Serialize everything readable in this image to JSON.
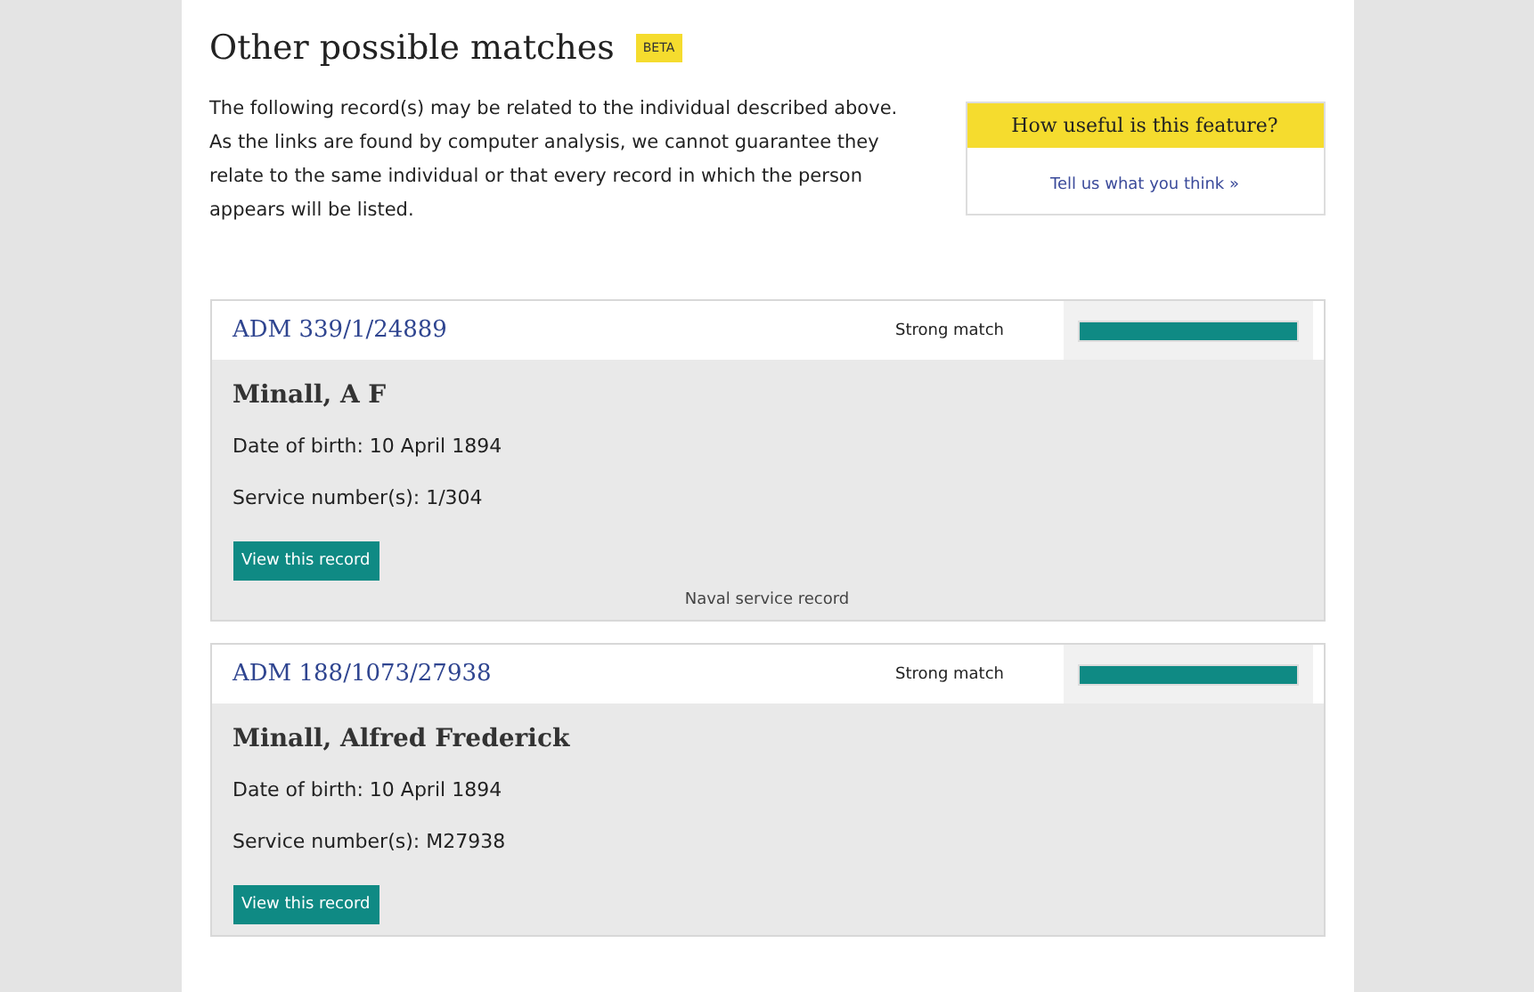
{
  "section": {
    "title": "Other possible matches",
    "badge": "BETA",
    "intro": "The following record(s) may be related to the individual described above. As the links are found by computer analysis, we cannot guarantee they relate to the same individual or that every record in which the person appears will be listed."
  },
  "feedback": {
    "question": "How useful is this feature?",
    "link": "Tell us what you think »"
  },
  "matches": [
    {
      "reference": "ADM 339/1/24889",
      "strength": "Strong match",
      "level": 1.0,
      "name": "Minall, A F",
      "birth": "Date of birth: 10 April 1894",
      "service": "Service number(s): 1/304",
      "button": "View this record",
      "record_type": "Naval service record"
    },
    {
      "reference": "ADM 188/1073/27938",
      "strength": "Strong match",
      "level": 1.0,
      "name": "Minall, Alfred Frederick",
      "birth": "Date of birth: 10 April 1894",
      "service": "Service number(s): M27938",
      "button": "View this record"
    }
  ]
}
